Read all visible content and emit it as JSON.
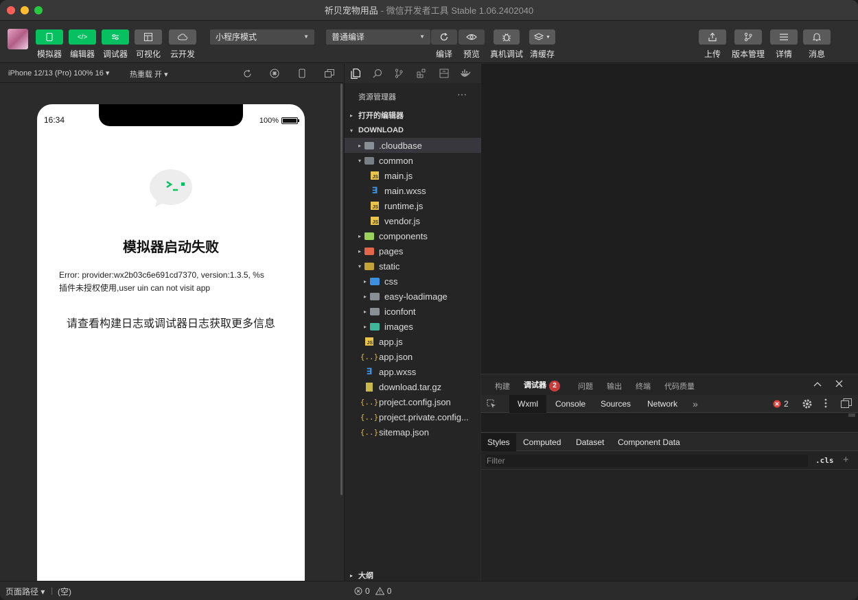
{
  "window": {
    "title_main": "祈贝宠物用品",
    "title_sub": "- 微信开发者工具 Stable 1.06.2402040"
  },
  "toolbar": {
    "simulator": "模拟器",
    "editor": "编辑器",
    "debugger": "调试器",
    "visual": "可视化",
    "cloud": "云开发",
    "mode_select": "小程序模式",
    "compile_select": "普通编译",
    "compile": "编译",
    "preview": "预览",
    "real_debug": "真机调试",
    "clear_cache": "清缓存",
    "upload": "上传",
    "version": "版本管理",
    "details": "详情",
    "messages": "消息"
  },
  "simbar": {
    "device": "iPhone 12/13 (Pro) 100% 16 ▾",
    "hot_reload": "热重载 开 ▾"
  },
  "phone": {
    "time": "16:34",
    "battery": "100%",
    "title": "模拟器启动失败",
    "error_line1": "Error: provider:wx2b03c6e691cd7370, version:1.3.5, %s",
    "error_line2": "插件未授权使用,user uin can not visit app",
    "hint": "请查看构建日志或调试器日志获取更多信息"
  },
  "explorer": {
    "header": "资源管理器",
    "more": "···",
    "open_editors": "打开的编辑器",
    "root": "DOWNLOAD",
    "outline": "大纲",
    "items": [
      {
        "label": ".cloudbase",
        "arrow": "▸",
        "icon": "folder",
        "color": "#8a8f96"
      },
      {
        "label": "common",
        "arrow": "▾",
        "icon": "folder-open",
        "color": "#8a8f96"
      },
      {
        "label": "main.js",
        "arrow": "",
        "icon": "js"
      },
      {
        "label": "main.wxss",
        "arrow": "",
        "icon": "css"
      },
      {
        "label": "runtime.js",
        "arrow": "",
        "icon": "js"
      },
      {
        "label": "vendor.js",
        "arrow": "",
        "icon": "js"
      },
      {
        "label": "components",
        "arrow": "▸",
        "icon": "folder",
        "color": "#9bd35a"
      },
      {
        "label": "pages",
        "arrow": "▸",
        "icon": "folder",
        "color": "#e3664a"
      },
      {
        "label": "static",
        "arrow": "▾",
        "icon": "folder-open",
        "color": "#e2b93b"
      },
      {
        "label": "css",
        "arrow": "▸",
        "icon": "folder",
        "color": "#3d8fe0"
      },
      {
        "label": "easy-loadimage",
        "arrow": "▸",
        "icon": "folder",
        "color": "#8a8f96"
      },
      {
        "label": "iconfont",
        "arrow": "▸",
        "icon": "folder",
        "color": "#8a8f96"
      },
      {
        "label": "images",
        "arrow": "▸",
        "icon": "folder",
        "color": "#3fb59a"
      },
      {
        "label": "app.js",
        "arrow": "",
        "icon": "js"
      },
      {
        "label": "app.json",
        "arrow": "",
        "icon": "json"
      },
      {
        "label": "app.wxss",
        "arrow": "",
        "icon": "css"
      },
      {
        "label": "download.tar.gz",
        "arrow": "",
        "icon": "gz"
      },
      {
        "label": "project.config.json",
        "arrow": "",
        "icon": "json"
      },
      {
        "label": "project.private.config...",
        "arrow": "",
        "icon": "json"
      },
      {
        "label": "sitemap.json",
        "arrow": "",
        "icon": "json"
      }
    ]
  },
  "debug": {
    "tabs": [
      "构建",
      "调试器",
      "问题",
      "输出",
      "终端",
      "代码质量"
    ],
    "badge": "2",
    "devtools_tabs": [
      "Wxml",
      "Console",
      "Sources",
      "Network"
    ],
    "error_count": "2",
    "styles_tabs": [
      "Styles",
      "Computed",
      "Dataset",
      "Component Data"
    ],
    "filter_placeholder": "Filter",
    "cls": ".cls",
    "plus": "+"
  },
  "status": {
    "page_path": "页面路径 ▾",
    "empty": "(空)",
    "errors": "0",
    "warnings": "0"
  }
}
